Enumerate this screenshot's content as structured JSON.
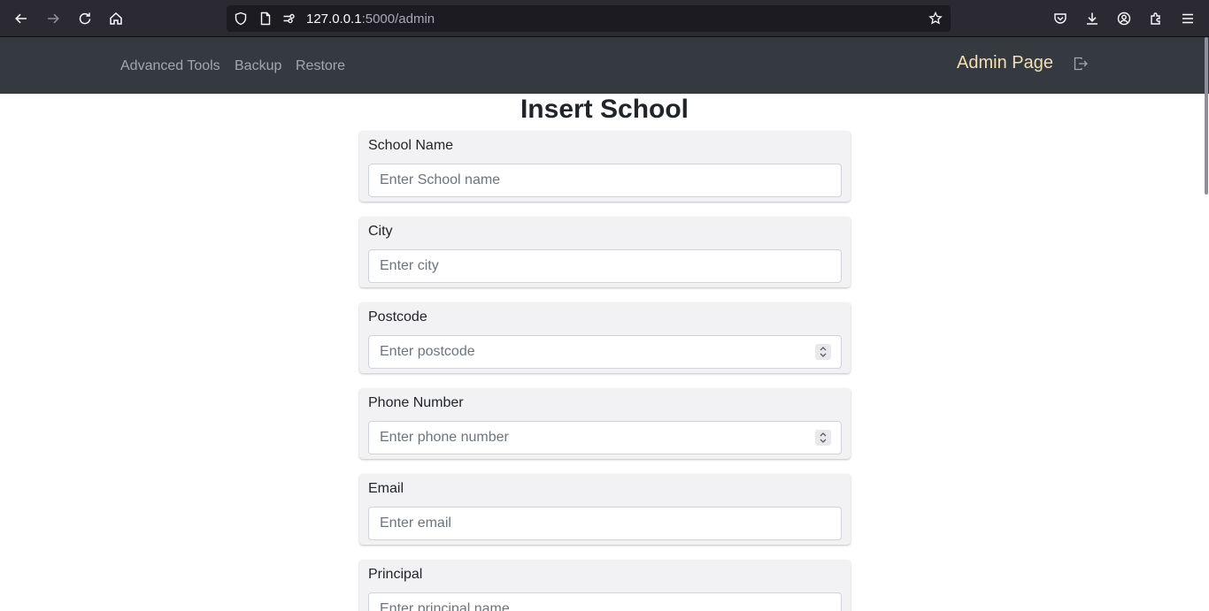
{
  "browser": {
    "url_host": "127.0.0.1",
    "url_rest": ":5000/admin"
  },
  "navbar": {
    "links": [
      "Advanced Tools",
      "Backup",
      "Restore"
    ],
    "brand": "Admin Page"
  },
  "form": {
    "title": "Insert School",
    "fields": [
      {
        "label": "School Name",
        "placeholder": "Enter School name",
        "type": "text"
      },
      {
        "label": "City",
        "placeholder": "Enter city",
        "type": "text"
      },
      {
        "label": "Postcode",
        "placeholder": "Enter postcode",
        "type": "number"
      },
      {
        "label": "Phone Number",
        "placeholder": "Enter phone number",
        "type": "number"
      },
      {
        "label": "Email",
        "placeholder": "Enter email",
        "type": "text"
      },
      {
        "label": "Principal",
        "placeholder": "Enter principal name",
        "type": "text"
      }
    ]
  }
}
